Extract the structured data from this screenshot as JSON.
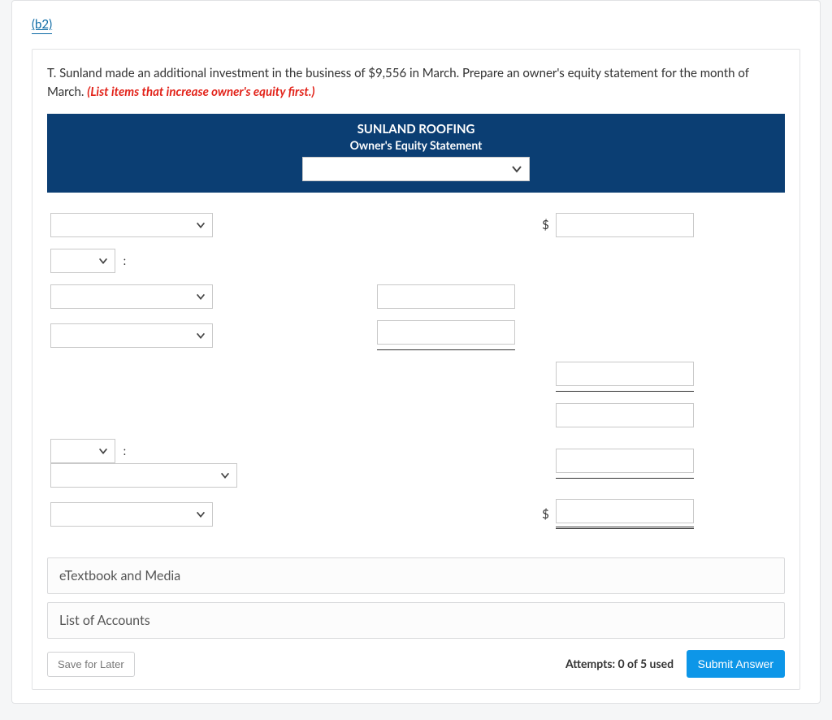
{
  "part_label": "(b2)",
  "prompt_text": "T. Sunland made an additional investment in the business of $9,556 in March. Prepare an owner's equity statement for the month of March. ",
  "instruction": "(List items that increase owner's equity first.)",
  "statement": {
    "company": "SUNLAND ROOFING",
    "title": "Owner's Equity Statement"
  },
  "currency": "$",
  "colon": ":",
  "resources": {
    "etextbook": "eTextbook and Media",
    "accounts": "List of Accounts"
  },
  "footer": {
    "save": "Save for Later",
    "attempts": "Attempts: 0 of 5 used",
    "submit": "Submit Answer"
  }
}
